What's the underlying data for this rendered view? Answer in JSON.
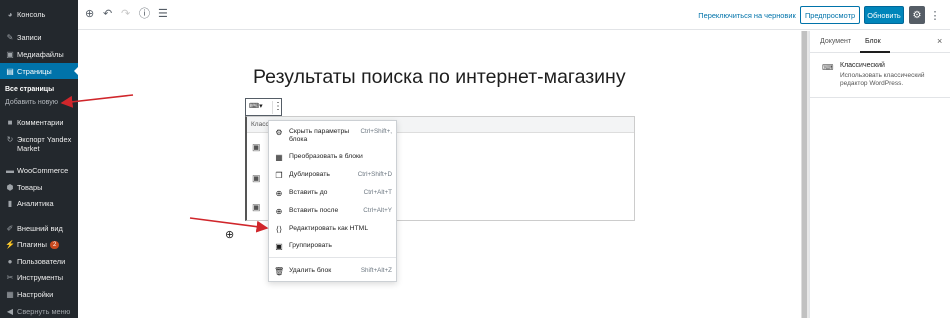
{
  "sidebar": {
    "items": [
      {
        "label": "Консоль",
        "icon": "dashboard-icon"
      },
      {
        "label": "Записи",
        "icon": "pin-icon"
      },
      {
        "label": "Медиафайлы",
        "icon": "media-icon"
      },
      {
        "label": "Страницы",
        "icon": "page-icon"
      },
      {
        "label": "Комментарии",
        "icon": "comment-icon"
      },
      {
        "label": "Экспорт Yandex Market",
        "icon": "export-icon"
      },
      {
        "label": "WooCommerce",
        "icon": "woocommerce-icon"
      },
      {
        "label": "Товары",
        "icon": "box-icon"
      },
      {
        "label": "Аналитика",
        "icon": "chart-icon"
      },
      {
        "label": "Внешний вид",
        "icon": "brush-icon"
      },
      {
        "label": "Плагины",
        "icon": "plugin-icon",
        "badge": "2"
      },
      {
        "label": "Пользователи",
        "icon": "user-icon"
      },
      {
        "label": "Инструменты",
        "icon": "wrench-icon"
      },
      {
        "label": "Настройки",
        "icon": "settings-icon"
      },
      {
        "label": "Свернуть меню",
        "icon": "collapse-icon"
      }
    ],
    "submenu": [
      "Все страницы",
      "Добавить новую"
    ]
  },
  "topbar": {
    "switch_draft": "Переключиться на черновик",
    "preview": "Предпросмотр",
    "update": "Обновить"
  },
  "editor": {
    "title": "Результаты поиска по интернет-магазину",
    "classic_label": "Класс"
  },
  "block_menu": {
    "items": [
      {
        "label": "Скрыть параметры блока",
        "shortcut": "Ctrl+Shift+,",
        "icon": "gear-icon"
      },
      {
        "label": "Преобразовать в блоки",
        "shortcut": "",
        "icon": "grid-icon"
      },
      {
        "label": "Дублировать",
        "shortcut": "Ctrl+Shift+D",
        "icon": "duplicate-icon"
      },
      {
        "label": "Вставить до",
        "shortcut": "Ctrl+Alt+T",
        "icon": "insert-before-icon"
      },
      {
        "label": "Вставить после",
        "shortcut": "Ctrl+Alt+Y",
        "icon": "insert-after-icon"
      },
      {
        "label": "Редактировать как HTML",
        "shortcut": "",
        "icon": "html-icon"
      },
      {
        "label": "Группировать",
        "shortcut": "",
        "icon": "group-icon"
      },
      {
        "label": "Удалить блок",
        "shortcut": "Shift+Alt+Z",
        "icon": "trash-icon"
      }
    ]
  },
  "panel": {
    "tab_document": "Документ",
    "tab_block": "Блок",
    "block_name": "Классический",
    "block_desc": "Использовать классический редактор WordPress."
  },
  "colors": {
    "sidebar": "#23282d",
    "accent": "#0073aa",
    "arrow": "#d0262b"
  }
}
